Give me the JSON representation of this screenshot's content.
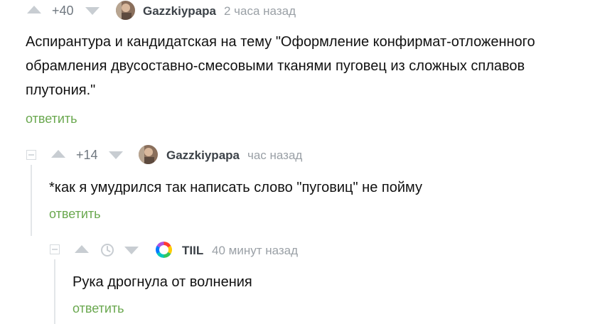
{
  "comments": [
    {
      "rating": "+40",
      "author": "Gazzkiypapa",
      "time": "2 часа назад",
      "text_lines": [
        "Аспирантура и кандидатская на тему \"Оформление конфирмат-отложенного",
        "обрамления двусоставно-смесовыми тканями пуговец из сложных сплавов",
        "плутония.\""
      ],
      "reply_label": "ответить"
    },
    {
      "rating": "+14",
      "author": "Gazzkiypapa",
      "time": "час назад",
      "text_lines": [
        "*как я умудрился так написать слово \"пуговиц\" не пойму"
      ],
      "reply_label": "ответить"
    },
    {
      "rating_icon": "clock-icon",
      "author": "TIIL",
      "time": "40 минут назад",
      "text_lines": [
        "Рука дрогнула от волнения"
      ],
      "reply_label": "ответить"
    }
  ],
  "colors": {
    "reply_link": "#6aa84f",
    "vote_arrow": "#c8cdd2",
    "author": "#3c4248",
    "time": "#9aa0a6"
  }
}
